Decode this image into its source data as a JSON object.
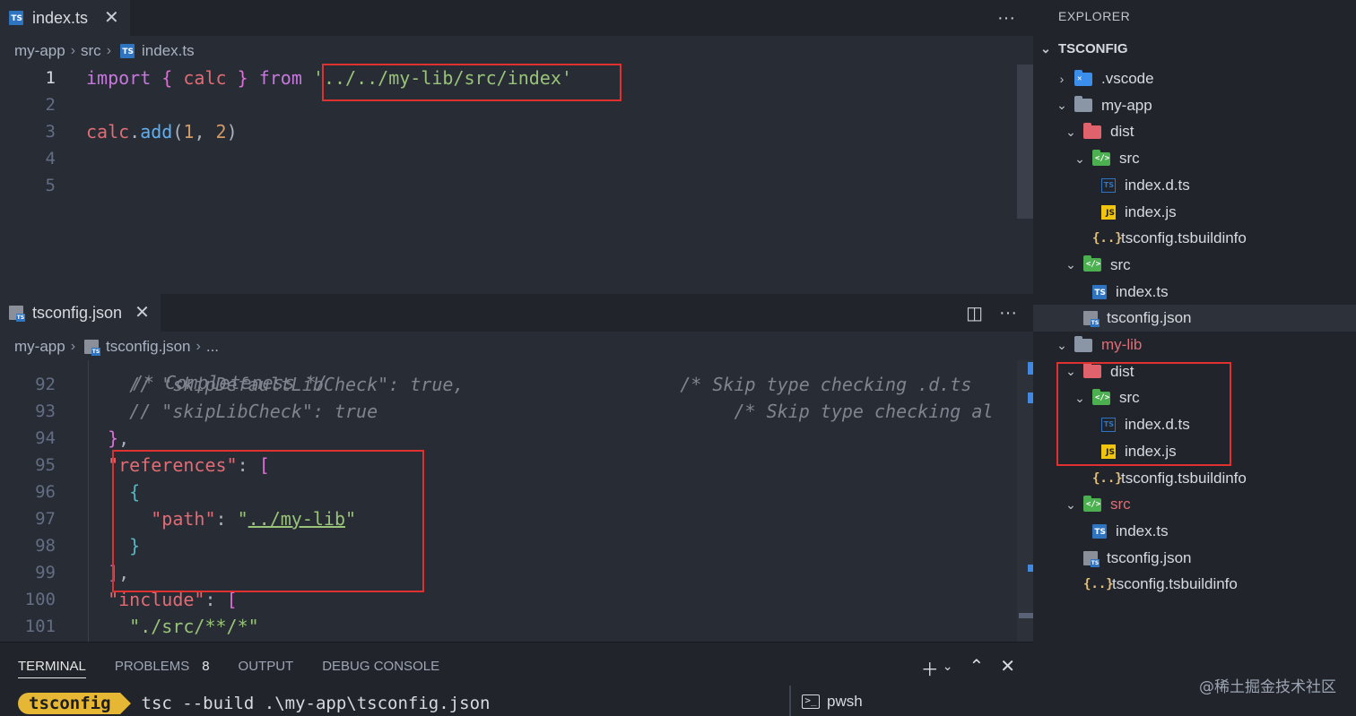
{
  "top_editor": {
    "tab": {
      "label": "index.ts"
    },
    "breadcrumb": [
      "my-app",
      "src",
      "index.ts"
    ],
    "lines": [
      {
        "n": "1",
        "tokens": [
          [
            "kw",
            "import"
          ],
          [
            "pun",
            " "
          ],
          [
            "br1",
            "{"
          ],
          [
            "pun",
            " "
          ],
          [
            "var",
            "calc"
          ],
          [
            "pun",
            " "
          ],
          [
            "br1",
            "}"
          ],
          [
            "pun",
            " "
          ],
          [
            "kw",
            "from"
          ],
          [
            "pun",
            " "
          ],
          [
            "str",
            "'../../my-lib/src/index'"
          ]
        ]
      },
      {
        "n": "2",
        "tokens": []
      },
      {
        "n": "3",
        "tokens": [
          [
            "var",
            "calc"
          ],
          [
            "pun",
            "."
          ],
          [
            "fn",
            "add"
          ],
          [
            "pun",
            "("
          ],
          [
            "num",
            "1"
          ],
          [
            "pun",
            ", "
          ],
          [
            "num",
            "2"
          ],
          [
            "pun",
            ")"
          ]
        ]
      },
      {
        "n": "4",
        "tokens": []
      },
      {
        "n": "5",
        "tokens": []
      }
    ]
  },
  "bottom_editor": {
    "tab": {
      "label": "tsconfig.json"
    },
    "breadcrumb": [
      "my-app",
      "tsconfig.json",
      "..."
    ],
    "partial_line": "/* Completeness */",
    "lines": [
      {
        "n": "92",
        "tokens": [
          [
            "pun",
            "    "
          ],
          [
            "cm",
            "// \"skipDefaultLibCheck\": true,                    /* Skip type checking .d.ts"
          ]
        ]
      },
      {
        "n": "93",
        "tokens": [
          [
            "pun",
            "    "
          ],
          [
            "cm",
            "// \"skipLibCheck\": true                                 /* Skip type checking al"
          ]
        ]
      },
      {
        "n": "94",
        "tokens": [
          [
            "pun",
            "  "
          ],
          [
            "br1",
            "}"
          ],
          [
            "pun",
            ","
          ]
        ]
      },
      {
        "n": "95",
        "tokens": [
          [
            "pun",
            "  "
          ],
          [
            "var",
            "\"references\""
          ],
          [
            "pun",
            ": "
          ],
          [
            "br1",
            "["
          ]
        ]
      },
      {
        "n": "96",
        "tokens": [
          [
            "pun",
            "    "
          ],
          [
            "br2",
            "{"
          ]
        ]
      },
      {
        "n": "97",
        "tokens": [
          [
            "pun",
            "      "
          ],
          [
            "var",
            "\"path\""
          ],
          [
            "pun",
            ": "
          ],
          [
            "str",
            "\""
          ],
          [
            "strU",
            "../my-lib"
          ],
          [
            "str",
            "\""
          ]
        ]
      },
      {
        "n": "98",
        "tokens": [
          [
            "pun",
            "    "
          ],
          [
            "br2",
            "}"
          ]
        ]
      },
      {
        "n": "99",
        "tokens": [
          [
            "pun",
            "  "
          ],
          [
            "br1",
            "]"
          ],
          [
            "pun",
            ","
          ]
        ]
      },
      {
        "n": "100",
        "tokens": [
          [
            "pun",
            "  "
          ],
          [
            "var",
            "\"include\""
          ],
          [
            "pun",
            ": "
          ],
          [
            "br1",
            "["
          ]
        ]
      },
      {
        "n": "101",
        "tokens": [
          [
            "pun",
            "    "
          ],
          [
            "str",
            "\"./src/**/*\""
          ]
        ]
      }
    ]
  },
  "panel": {
    "tabs": [
      "TERMINAL",
      "PROBLEMS",
      "OUTPUT",
      "DEBUG CONSOLE"
    ],
    "problems_count": "8",
    "prompt_dir": "tsconfig",
    "command": "tsc --build .\\my-app\\tsconfig.json",
    "shell": "pwsh"
  },
  "explorer": {
    "title": "EXPLORER",
    "section": "TSCONFIG",
    "tree": [
      {
        "label": ".vscode",
        "depth": 0,
        "chev": "right",
        "icon": "folder-vscode"
      },
      {
        "label": "my-app",
        "depth": 0,
        "chev": "down",
        "icon": "folder-open"
      },
      {
        "label": "dist",
        "depth": 1,
        "chev": "down",
        "icon": "folder-dist"
      },
      {
        "label": "src",
        "depth": 2,
        "chev": "down",
        "icon": "folder-src"
      },
      {
        "label": "index.d.ts",
        "depth": 3,
        "chev": "none",
        "icon": "dts"
      },
      {
        "label": "index.js",
        "depth": 3,
        "chev": "none",
        "icon": "js"
      },
      {
        "label": "tsconfig.tsbuildinfo",
        "depth": 2,
        "chev": "none",
        "icon": "brace"
      },
      {
        "label": "src",
        "depth": 1,
        "chev": "down",
        "icon": "folder-src"
      },
      {
        "label": "index.ts",
        "depth": 2,
        "chev": "none",
        "icon": "ts"
      },
      {
        "label": "tsconfig.json",
        "depth": 1,
        "chev": "none",
        "icon": "json",
        "selected": true
      },
      {
        "label": "my-lib",
        "depth": 0,
        "chev": "down",
        "icon": "folder-open",
        "red": true
      },
      {
        "label": "dist",
        "depth": 1,
        "chev": "down",
        "icon": "folder-dist"
      },
      {
        "label": "src",
        "depth": 2,
        "chev": "down",
        "icon": "folder-src"
      },
      {
        "label": "index.d.ts",
        "depth": 3,
        "chev": "none",
        "icon": "dts"
      },
      {
        "label": "index.js",
        "depth": 3,
        "chev": "none",
        "icon": "js"
      },
      {
        "label": "tsconfig.tsbuildinfo",
        "depth": 2,
        "chev": "none",
        "icon": "brace"
      },
      {
        "label": "src",
        "depth": 1,
        "chev": "down",
        "icon": "folder-src",
        "red": true
      },
      {
        "label": "index.ts",
        "depth": 2,
        "chev": "none",
        "icon": "ts"
      },
      {
        "label": "tsconfig.json",
        "depth": 1,
        "chev": "none",
        "icon": "json"
      },
      {
        "label": "tsconfig.tsbuildinfo",
        "depth": 1,
        "chev": "none",
        "icon": "brace"
      }
    ]
  },
  "watermark": "@稀土掘金技术社区",
  "colors": {
    "annotation_box": "#e03131",
    "ts_blue": "#2f74c0",
    "js_yellow": "#f1c40f"
  }
}
